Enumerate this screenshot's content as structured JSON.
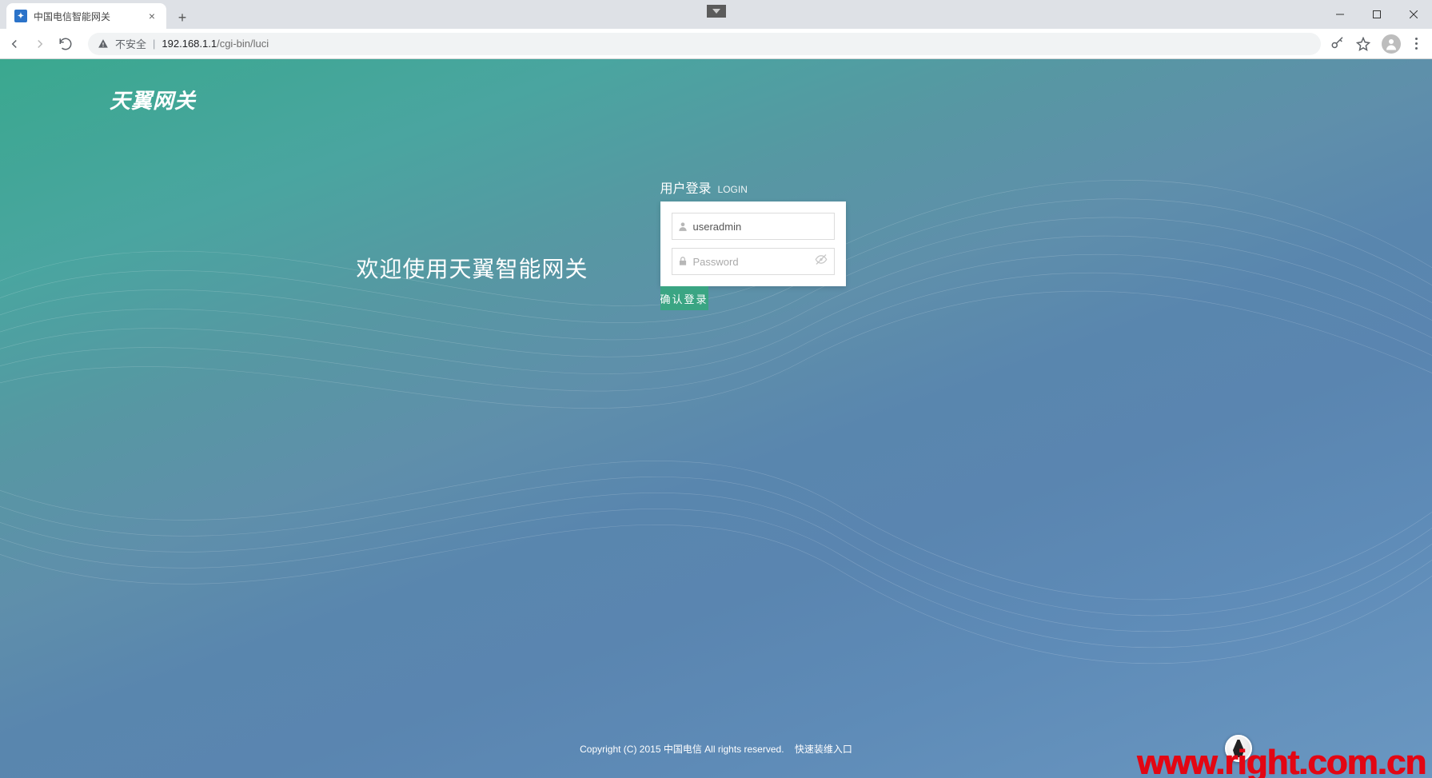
{
  "browser": {
    "tab_title": "中国电信智能网关",
    "insecure_label": "不安全",
    "url_host": "192.168.1.1",
    "url_path": "/cgi-bin/luci"
  },
  "brand": {
    "text": "天翼网关"
  },
  "welcome": {
    "text": "欢迎使用天翼智能网关"
  },
  "login": {
    "title_cn": "用户登录",
    "title_en": "LOGIN",
    "username_value": "useradmin",
    "password_value": "",
    "password_placeholder": "Password",
    "submit_label": "确认登录"
  },
  "footer": {
    "copyright": "Copyright (C) 2015 中国电信 All rights reserved.",
    "quick_link": "快速装维入口"
  },
  "watermark": {
    "text": "www.right.com.cn"
  }
}
